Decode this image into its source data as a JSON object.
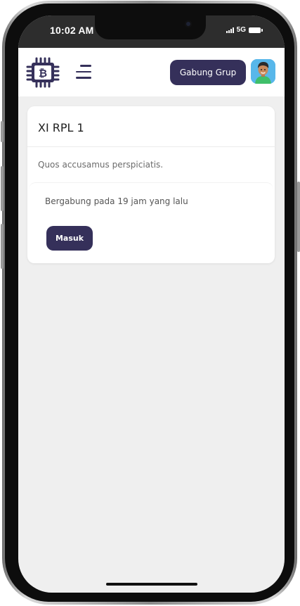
{
  "status_bar": {
    "time": "10:02 AM",
    "network": "5G"
  },
  "header": {
    "logo_icon": "bitcoin-chip-icon",
    "menu_icon": "hamburger-menu-icon",
    "join_button_label": "Gabung Grup",
    "avatar_icon": "user-avatar"
  },
  "group_card": {
    "title": "XI RPL 1",
    "description": "Quos accusamus perspiciatis.",
    "joined_text": "Bergabung pada 19 jam yang lalu",
    "enter_button_label": "Masuk"
  },
  "colors": {
    "primary": "#35305a",
    "background": "#efefef",
    "status_bar": "#2d2d2d"
  }
}
